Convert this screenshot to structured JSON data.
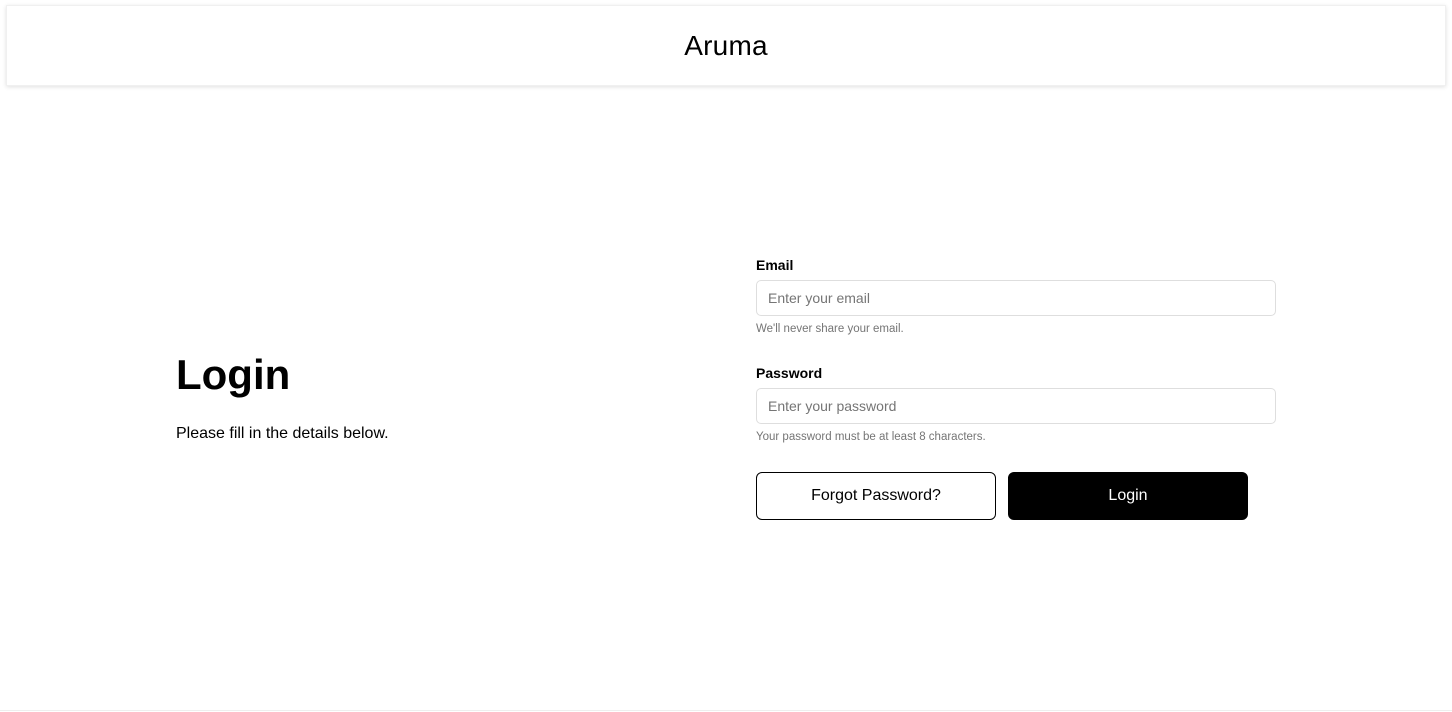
{
  "header": {
    "brand": "Aruma"
  },
  "intro": {
    "title": "Login",
    "subtitle": "Please fill in the details below."
  },
  "form": {
    "email": {
      "label": "Email",
      "placeholder": "Enter your email",
      "value": "",
      "hint": "We'll never share your email."
    },
    "password": {
      "label": "Password",
      "placeholder": "Enter your password",
      "value": "",
      "hint": "Your password must be at least 8 characters."
    },
    "forgot_label": "Forgot Password?",
    "login_label": "Login"
  },
  "colors": {
    "primary": "#000000",
    "background": "#ffffff",
    "hint_text": "#757575",
    "input_border": "#dedede"
  }
}
